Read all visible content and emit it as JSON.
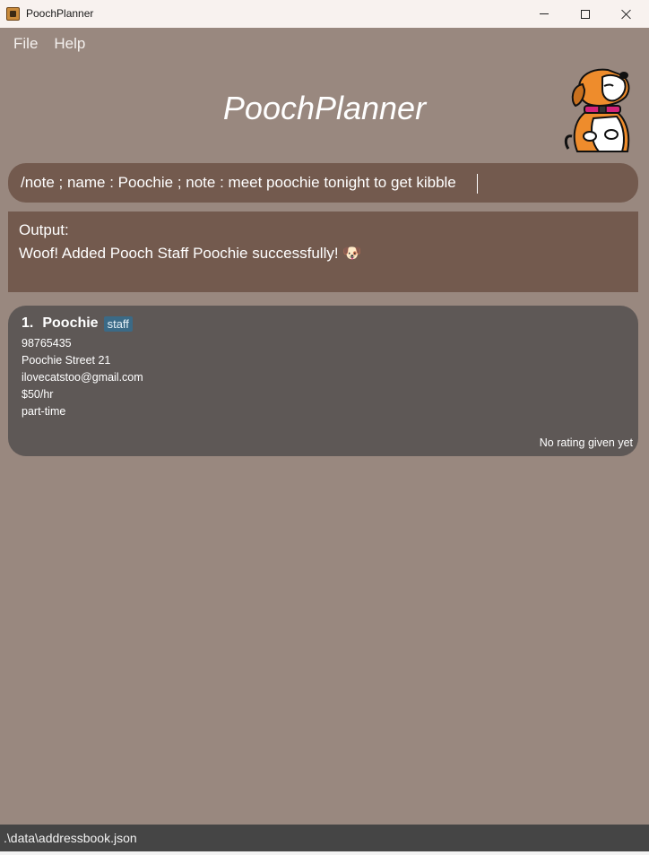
{
  "window": {
    "title": "PoochPlanner"
  },
  "menu": {
    "items": [
      "File",
      "Help"
    ]
  },
  "header": {
    "title": "PoochPlanner"
  },
  "command": {
    "value": "/note ; name : Poochie ; note : meet poochie tonight to get kibble"
  },
  "output": {
    "label": "Output:",
    "message": "Woof! Added Pooch Staff Poochie successfully! 🐶"
  },
  "contacts": [
    {
      "index": "1.",
      "name": "Poochie",
      "tag": "staff",
      "phone": "98765435",
      "address": "Poochie Street 21",
      "email": "ilovecatstoo@gmail.com",
      "salary": "$50/hr",
      "employment": "part-time",
      "rating": "No rating given yet"
    }
  ],
  "status": {
    "path": ".\\data\\addressbook.json"
  },
  "colors": {
    "background": "#99887f",
    "panel": "#735a4e",
    "card": "#5e5856",
    "tag": "#3b6a86",
    "statusbar": "#454545"
  },
  "icons": {
    "app": "app-logo-icon",
    "mascot": "dog-mascot-icon"
  }
}
